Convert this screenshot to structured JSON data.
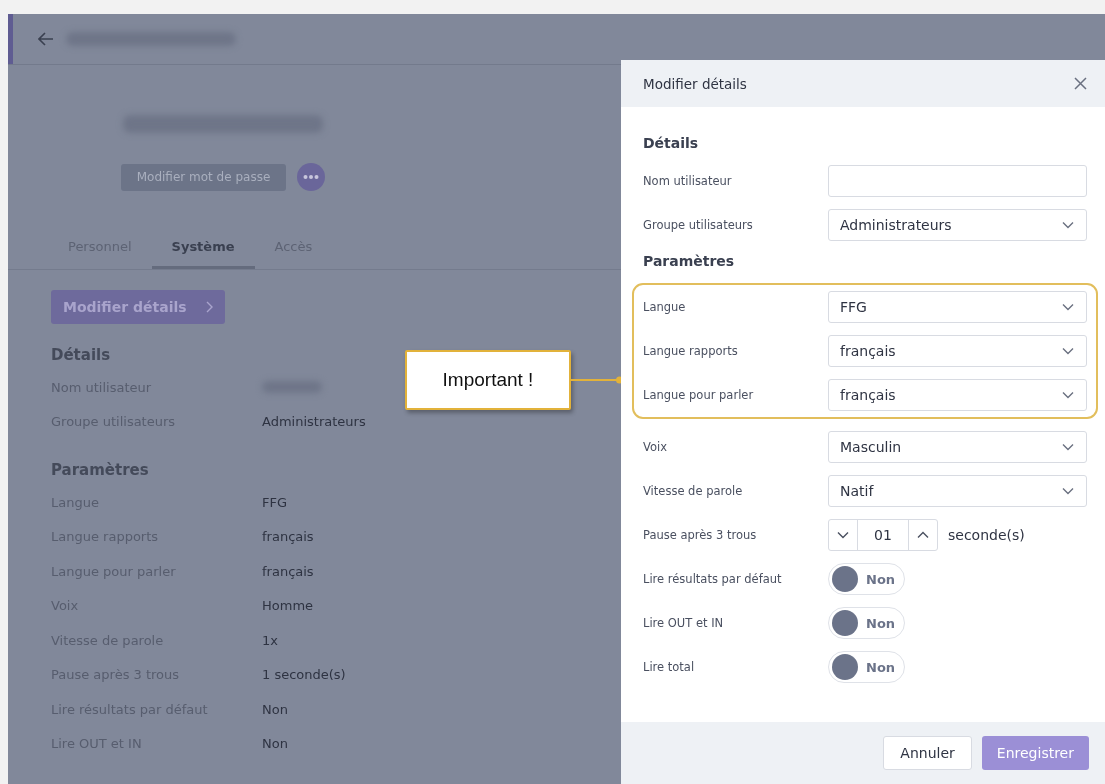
{
  "page": {
    "change_password_button": "Modifier mot de passe",
    "tabs": [
      {
        "label": "Personnel",
        "selected": false
      },
      {
        "label": "Système",
        "selected": true
      },
      {
        "label": "Accès",
        "selected": false
      }
    ],
    "edit_details_button": "Modifier détails",
    "details_heading": "Détails",
    "details": [
      {
        "label": "Nom utilisateur",
        "redacted": true
      },
      {
        "label": "Groupe utilisateurs",
        "value": "Administrateurs"
      }
    ],
    "settings_heading": "Paramètres",
    "settings": [
      {
        "label": "Langue",
        "value": "FFG"
      },
      {
        "label": "Langue rapports",
        "value": "français"
      },
      {
        "label": "Langue pour parler",
        "value": "français"
      },
      {
        "label": "Voix",
        "value": "Homme"
      },
      {
        "label": "Vitesse de parole",
        "value": "1x"
      },
      {
        "label": "Pause après 3 trous",
        "value": "1 seconde(s)"
      },
      {
        "label": "Lire résultats par défaut",
        "value": "Non"
      },
      {
        "label": "Lire OUT et IN",
        "value": "Non"
      }
    ]
  },
  "drawer": {
    "title": "Modifier détails",
    "details_heading": "Détails",
    "details": [
      {
        "kind": "text",
        "label": "Nom utilisateur"
      },
      {
        "kind": "select",
        "label": "Groupe utilisateurs",
        "value": "Administrateurs"
      }
    ],
    "settings_heading": "Paramètres",
    "highlighted": [
      {
        "kind": "select",
        "label": "Langue",
        "value": "FFG"
      },
      {
        "kind": "select",
        "label": "Langue rapports",
        "value": "français"
      },
      {
        "kind": "select",
        "label": "Langue pour parler",
        "value": "français"
      }
    ],
    "settings": [
      {
        "kind": "select",
        "label": "Voix",
        "value": "Masculin"
      },
      {
        "kind": "select",
        "label": "Vitesse de parole",
        "value": "Natif"
      },
      {
        "kind": "stepper",
        "label": "Pause après 3 trous",
        "value": "01",
        "unit": "seconde(s)"
      },
      {
        "kind": "toggle",
        "label": "Lire résultats par défaut",
        "on": false,
        "text": "Non"
      },
      {
        "kind": "toggle",
        "label": "Lire OUT et IN",
        "on": false,
        "text": "Non"
      },
      {
        "kind": "toggle",
        "label": "Lire total",
        "on": false,
        "text": "Non"
      }
    ],
    "cancel_button": "Annuler",
    "save_button": "Enregistrer"
  },
  "callout": {
    "text": "Important !"
  }
}
